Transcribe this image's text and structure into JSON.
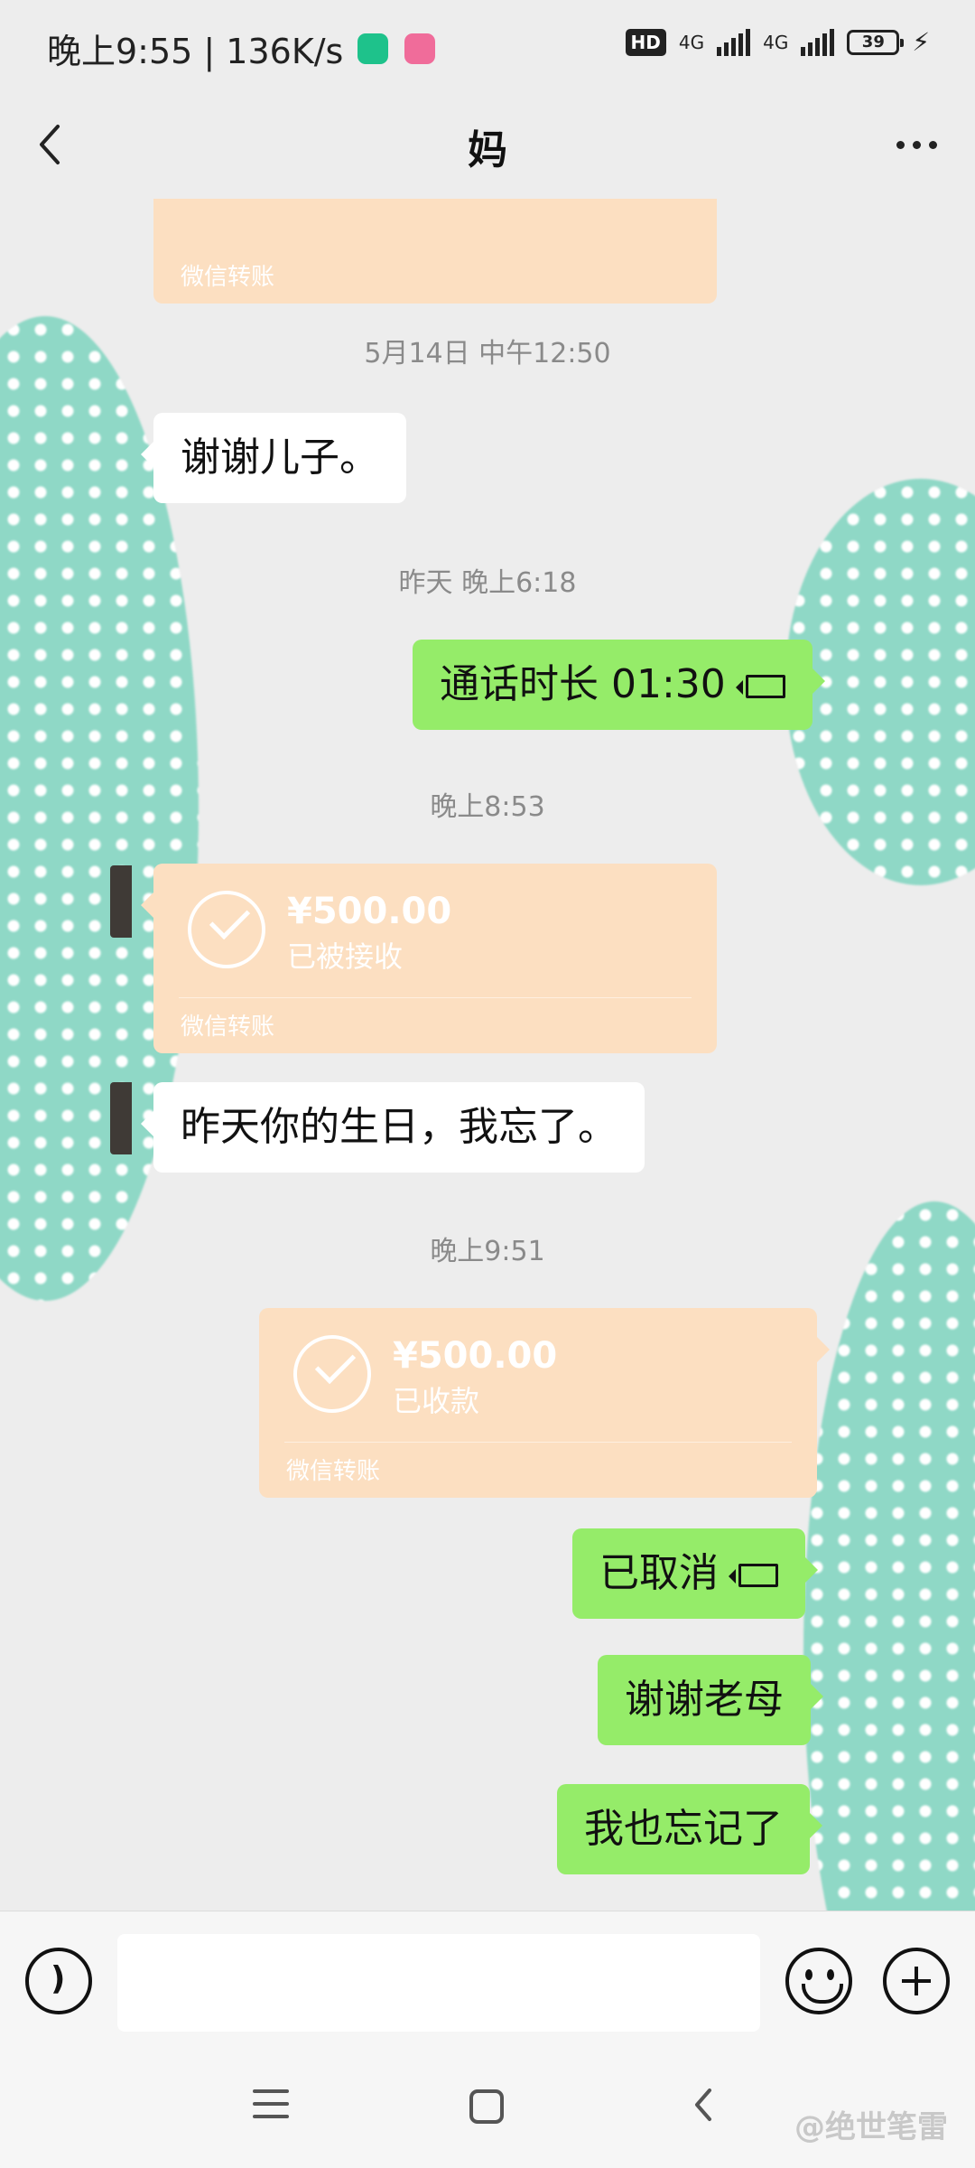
{
  "status_bar": {
    "time_speed": "晚上9:55 | 136K/s",
    "hd": "HD",
    "net1": "4G",
    "net2": "4G",
    "battery": "39"
  },
  "header": {
    "title": "妈"
  },
  "chat": {
    "top_transfer_footer": "微信转账",
    "ts1": "5月14日 中午12:50",
    "msg1": "谢谢儿子。",
    "ts2": "昨天 晚上6:18",
    "call_label": "通话时长 01:30",
    "ts3": "晚上8:53",
    "transfer1": {
      "amount": "¥500.00",
      "status": "已被接收",
      "footer": "微信转账"
    },
    "msg2": "昨天你的生日，我忘了。",
    "ts4": "晚上9:51",
    "transfer2": {
      "amount": "¥500.00",
      "status": "已收款",
      "footer": "微信转账"
    },
    "cancel_label": "已取消",
    "msg3": "谢谢老母",
    "msg4": "我也忘记了"
  },
  "watermark": "@绝世笔雷",
  "colors": {
    "my_bubble": "#95ec69",
    "their_bubble": "#ffffff",
    "transfer_bg": "#fcdfc1",
    "background": "#ededed"
  },
  "icons": {
    "back": "back-chevron-icon",
    "more": "more-dots-icon",
    "voice": "voice-icon",
    "emoji": "emoji-icon",
    "plus": "plus-icon",
    "call": "video-call-icon",
    "check": "check-circle-icon"
  }
}
